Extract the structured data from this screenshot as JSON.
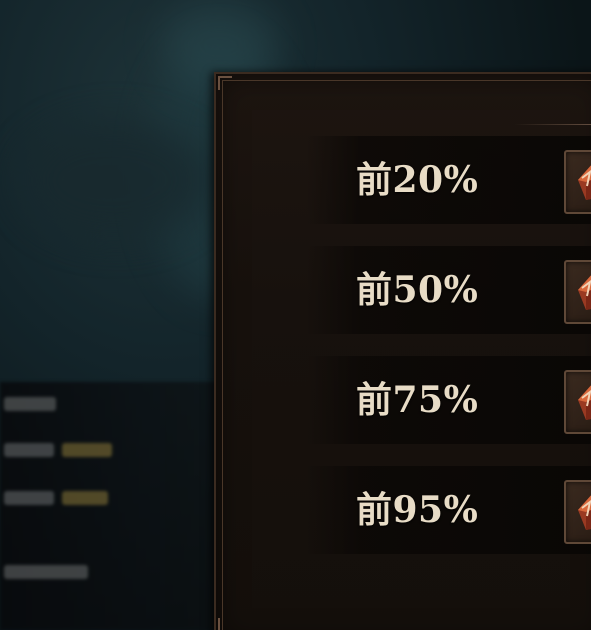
{
  "ranking_panel": {
    "tiers": [
      {
        "label": "前20%",
        "reward_icon": "red-crystal-icon"
      },
      {
        "label": "前50%",
        "reward_icon": "red-crystal-icon"
      },
      {
        "label": "前75%",
        "reward_icon": "red-crystal-icon"
      },
      {
        "label": "前95%",
        "reward_icon": "red-crystal-icon"
      }
    ]
  },
  "colors": {
    "label_text": "#e8dcc6",
    "panel_bg": "#1d1510",
    "frame_border": "#5f4837",
    "background_teal": "#1e3338"
  }
}
